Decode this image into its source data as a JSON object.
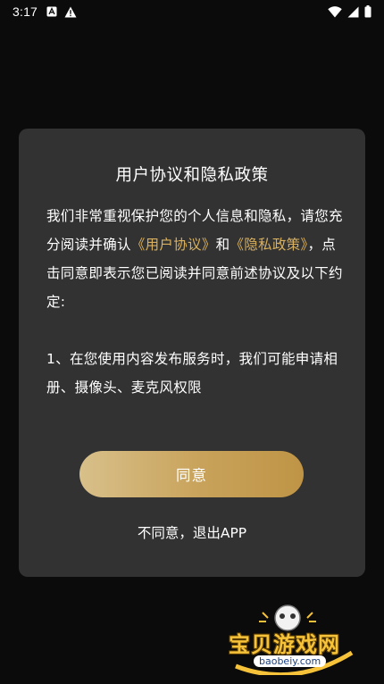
{
  "status_bar": {
    "time": "3:17",
    "left_icons": [
      "notification-a-icon",
      "warning-icon"
    ],
    "right_icons": [
      "wifi-icon",
      "cellular-signal-icon",
      "battery-icon"
    ]
  },
  "dialog": {
    "title": "用户协议和隐私政策",
    "body_part1": "我们非常重视保护您的个人信息和隐私，请您充分阅读并确认",
    "link_user_agreement": "《用户协议》",
    "connector_and": "和",
    "link_privacy_policy": "《隐私政策》",
    "body_part2": "，点击同意即表示您已阅读并同意前述协议及以下约定:",
    "item_1": "1、在您使用内容发布服务时，我们可能申请相册、摄像头、麦克风权限",
    "agree_label": "同意",
    "disagree_label": "不同意，退出APP"
  },
  "watermark": {
    "name": "宝贝游戏网",
    "url": "baobeiy.com"
  },
  "colors": {
    "background": "#0b0b0c",
    "dialog": "#323232",
    "link": "#d8b060",
    "button_gradient_start": "#d8c08a",
    "button_gradient_end": "#bf9446"
  }
}
